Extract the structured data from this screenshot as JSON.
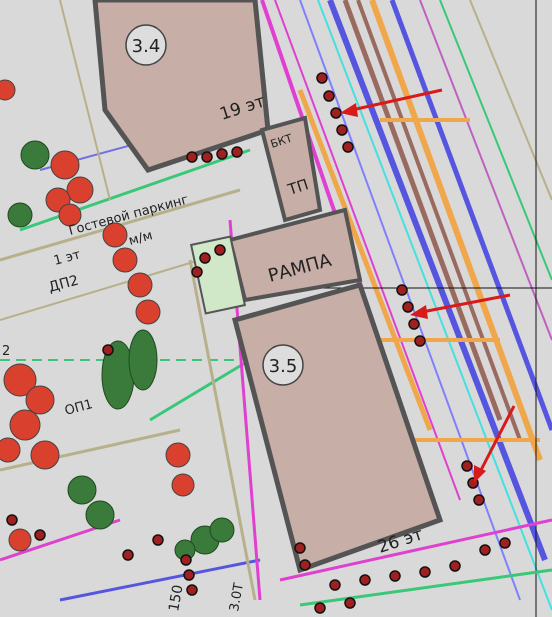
{
  "buildings": {
    "b34": {
      "number": "3.4",
      "floors": "19 эт"
    },
    "b35": {
      "number": "3.5",
      "floors": "26 эт"
    }
  },
  "labels": {
    "bkt": "БКТ",
    "tp": "ТП",
    "ramp": "РАМПА",
    "parking": "Гостевой паркинг",
    "mm": "м/м",
    "dp2_floor": "1 эт",
    "dp2": "ДП2",
    "op1": "ОП1",
    "dim_150": "150",
    "dim_30": "3.0Т",
    "left_digit": "2"
  },
  "colors": {
    "building_fill": "#c7aea6",
    "building_outline": "#545454",
    "magenta": "#e040d0",
    "orange": "#f0a64a",
    "blue": "#5555e0",
    "cyan": "#45e0e0",
    "green": "#38c878",
    "olive": "#b7b08a",
    "tree_red": "#d9402e",
    "arrow": "#d81a1a"
  },
  "icons": {
    "annotation_arrows": "red-arrow",
    "trees": "tree-circle"
  }
}
